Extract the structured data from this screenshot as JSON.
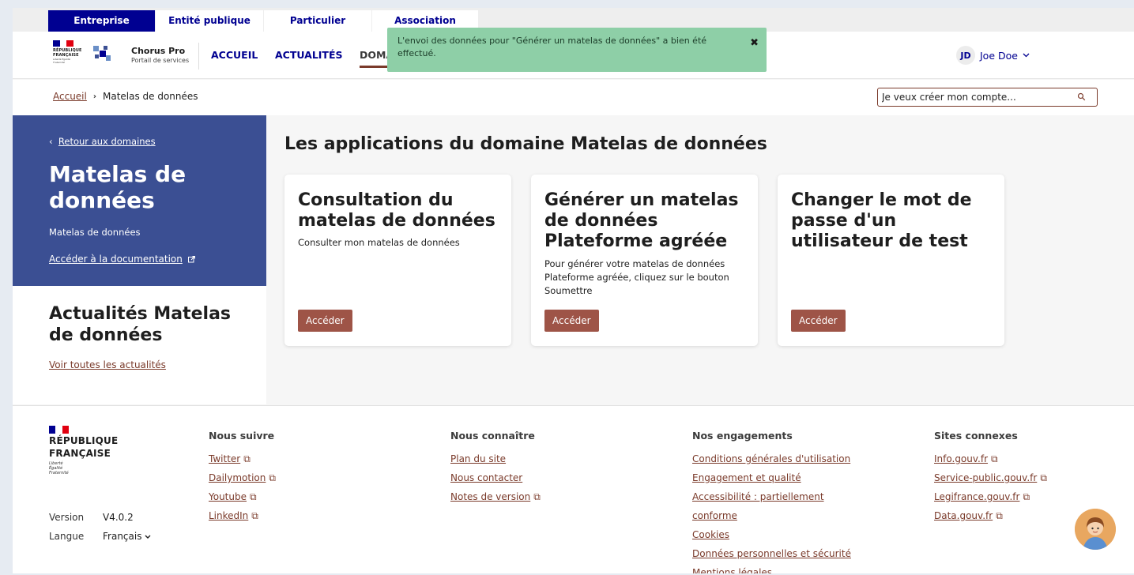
{
  "audience_tabs": [
    "Entreprise",
    "Entité publique",
    "Particulier",
    "Association"
  ],
  "header": {
    "brand_line1": "RÉPUBLIQUE",
    "brand_line2": "FRANÇAISE",
    "motto": "Liberté Égalité Fraternité",
    "app_title": "Chorus Pro",
    "app_subtitle": "Portail de services",
    "nav": [
      "ACCUEIL",
      "ACTUALITÉS",
      "DOMA"
    ],
    "user_initials": "JD",
    "user_name": "Joe Doe"
  },
  "toast": {
    "message": "L'envoi des données pour \"Générer un matelas de données\" a bien été effectué.",
    "close": "✖"
  },
  "breadcrumb": {
    "home": "Accueil",
    "separator": "›",
    "current": "Matelas de données"
  },
  "search": {
    "value": "Je veux créer mon compte..."
  },
  "sidebar": {
    "back": "Retour aux domaines",
    "back_chevron": "‹",
    "title": "Matelas de données",
    "subtitle": "Matelas de données",
    "doc_link": "Accéder à la documentation",
    "news_title": "Actualités Matelas de données",
    "news_link": "Voir toutes les actualités"
  },
  "main": {
    "title": "Les applications du domaine Matelas de données",
    "cards": [
      {
        "title": "Consultation du matelas de données",
        "desc": "Consulter mon matelas de données",
        "button": "Accéder"
      },
      {
        "title": "Générer un matelas de données Plateforme agréée",
        "desc": "Pour générer votre matelas de données Plateforme agréée, cliquez sur le bouton Soumettre",
        "button": "Accéder"
      },
      {
        "title": "Changer le mot de passe d'un utilisateur de test",
        "desc": "",
        "button": "Accéder"
      }
    ]
  },
  "footer": {
    "brand_line1": "RÉPUBLIQUE",
    "brand_line2": "FRANÇAISE",
    "motto_1": "Liberté",
    "motto_2": "Égalité",
    "motto_3": "Fraternité",
    "version_label": "Version",
    "version_value": "V4.0.2",
    "lang_label": "Langue",
    "lang_value": "Français",
    "columns": [
      {
        "title": "Nous suivre",
        "links": [
          "Twitter",
          "Dailymotion",
          "Youtube",
          "LinkedIn"
        ]
      },
      {
        "title": "Nous connaître",
        "links": [
          "Plan du site",
          "Nous contacter",
          "Notes de version"
        ]
      },
      {
        "title": "Nos engagements",
        "links": [
          "Conditions générales d'utilisation",
          "Engagement et qualité",
          "Accessibilité : partiellement",
          "conforme",
          "Cookies",
          "Données personnelles et sécurité",
          "Mentions légales"
        ]
      },
      {
        "title": "Sites connexes",
        "links": [
          "Info.gouv.fr",
          "Service-public.gouv.fr",
          "Legifrance.gouv.fr",
          "Data.gouv.fr"
        ]
      }
    ]
  },
  "colors": {
    "primary_blue": "#000091",
    "panel_blue": "#3b4f93",
    "accent_brown": "#9e5447",
    "toast_green": "#8ecfa7",
    "flag_blue": "#000091",
    "flag_red": "#e1000f"
  },
  "icons": {
    "user_menu": "chevron-down-icon",
    "search": "search-icon",
    "external": "external-link-icon",
    "helper": "assistant-avatar-icon"
  }
}
